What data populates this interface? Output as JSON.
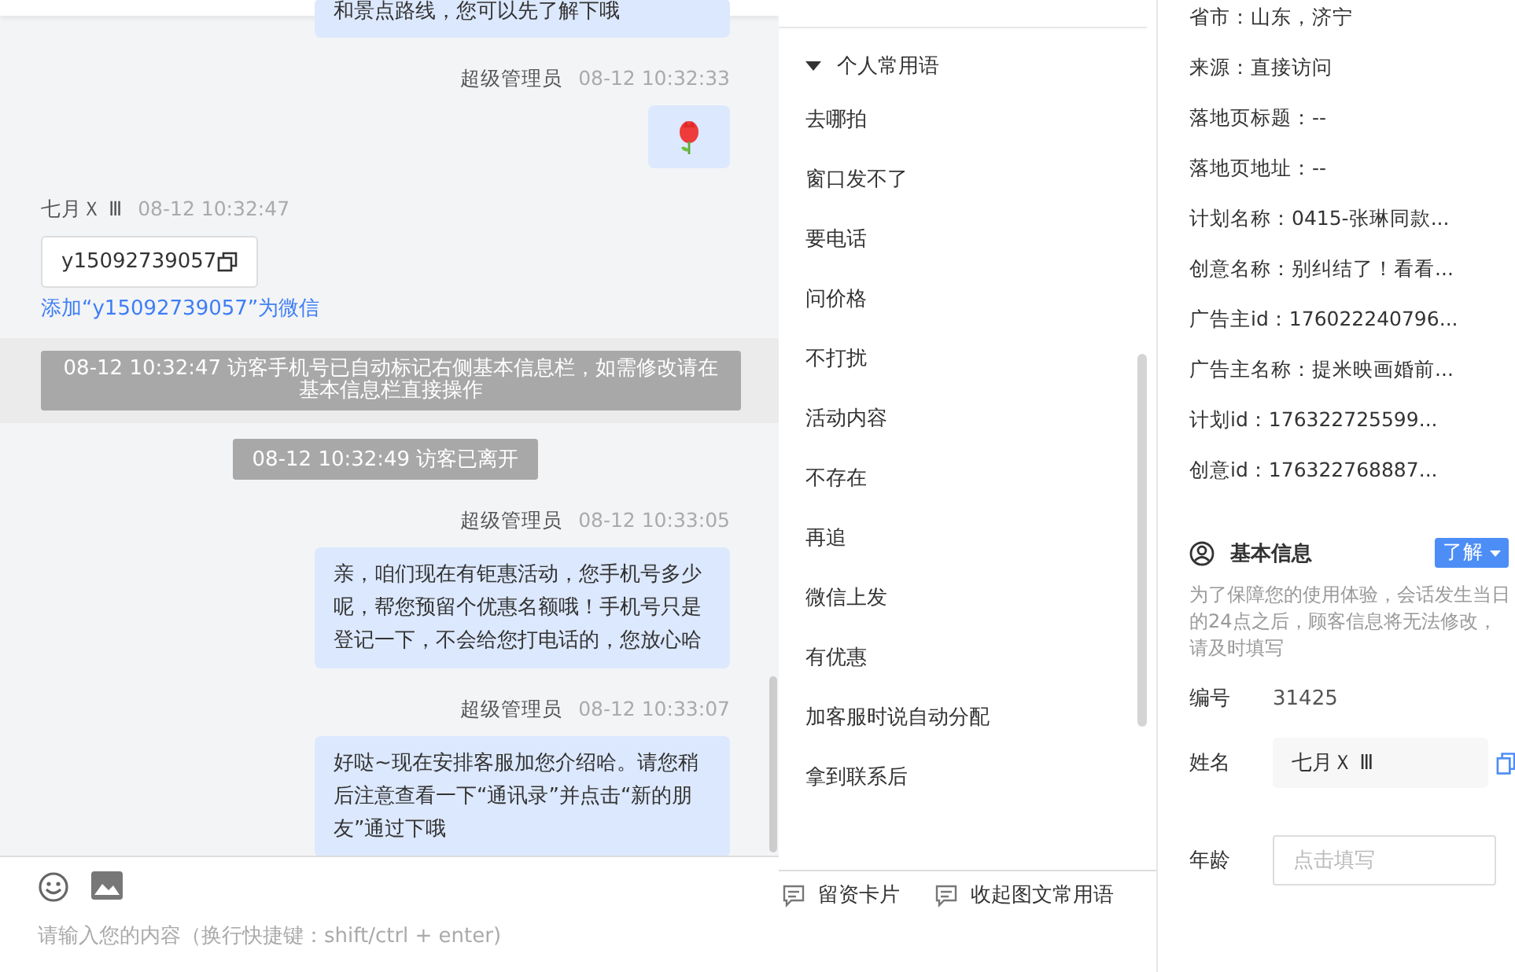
{
  "chat": {
    "messages": [
      {
        "kind": "bubble",
        "text": "和景点路线，您可以先了解下哦"
      },
      {
        "kind": "sent-header",
        "sender": "超级管理员",
        "time": "08-12 10:32:33"
      },
      {
        "kind": "emoji"
      },
      {
        "kind": "received-header",
        "sender": "七月Ｘ Ⅲ",
        "time": "08-12 10:32:47"
      },
      {
        "kind": "copy-card",
        "text": "y15092739057",
        "link": "添加“y15092739057”为微信"
      },
      {
        "kind": "notice",
        "text": "08-12 10:32:47 访客手机号已自动标记右侧基本信息栏，如需修改请在基本信息栏直接操作"
      },
      {
        "kind": "system",
        "text": "08-12 10:32:49 访客已离开"
      },
      {
        "kind": "sent-header",
        "sender": "超级管理员",
        "time": "08-12 10:33:05"
      },
      {
        "kind": "bubble",
        "text": "亲，咱们现在有钜惠活动，您手机号多少呢，帮您预留个优惠名额哦！手机号只是登记一下，不会给您打电话的，您放心哈"
      },
      {
        "kind": "sent-header",
        "sender": "超级管理员",
        "time": "08-12 10:33:07"
      },
      {
        "kind": "bubble",
        "text": "好哒~现在安排客服加您介绍哈。请您稍后注意查看一下“通讯录”并点击“新的朋友”通过下哦"
      }
    ],
    "input": {
      "placeholder": "请输入您的内容（换行快捷键：shift/ctrl + enter)"
    }
  },
  "phrases": {
    "group": {
      "title": "个人常用语",
      "expanded": true
    },
    "items": [
      "去哪拍",
      "窗口发不了",
      "要电话",
      "问价格",
      "不打扰",
      "活动内容",
      "不存在",
      "再追",
      "微信上发",
      "有优惠",
      "加客服时说自动分配",
      "拿到联系后"
    ],
    "buttons": [
      "留资卡片",
      "收起图文常用语"
    ]
  },
  "info": {
    "lines": [
      "省市：山东，济宁",
      "来源：直接访问",
      "落地页标题：--",
      "落地页地址：--",
      "计划名称：0415-张琳同款...",
      "创意名称：别纠结了！看看...",
      "广告主id：176022240796...",
      "广告主名称：提米映画婚前...",
      "计划id：176322725599...",
      "创意id：176322768887..."
    ],
    "section": {
      "title": "基本信息",
      "button": "了解",
      "note": "为了保障您的使用体验，会话发生当日的24点之后，顾客信息将无法修改，请及时填写"
    },
    "fields": [
      {
        "label": "编号",
        "kind": "text",
        "value": "31425"
      },
      {
        "label": "姓名",
        "kind": "filled",
        "value": "七月Ｘ Ⅲ"
      },
      {
        "label": "年龄",
        "kind": "input",
        "placeholder": "点击填写"
      }
    ]
  }
}
